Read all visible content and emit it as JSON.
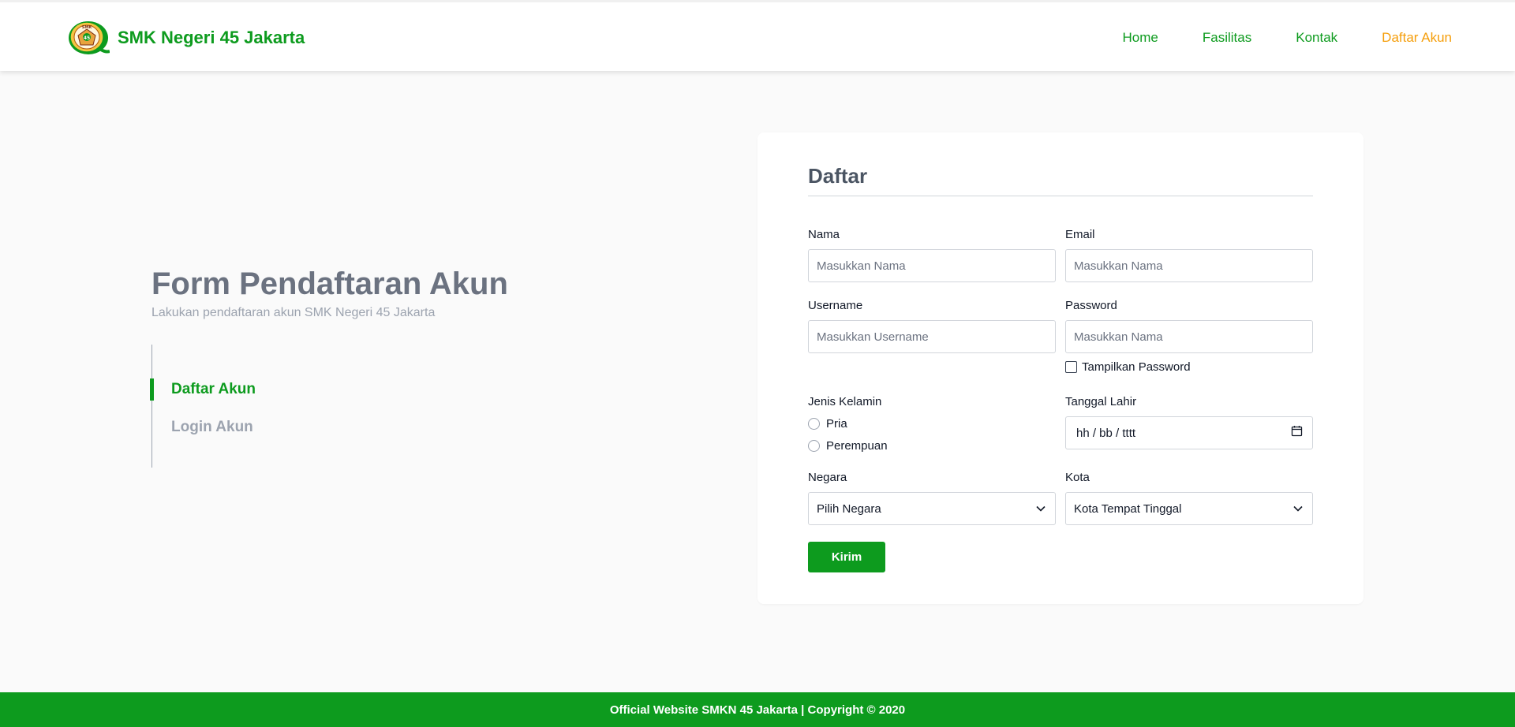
{
  "colors": {
    "brand": "#0d9b1e",
    "active_nav": "#f59e0b",
    "muted": "#9ca3af",
    "heading": "#6b7280"
  },
  "header": {
    "logo_icon": "school-emblem-icon",
    "logo_text": "SMK",
    "brand_name": "SMK Negeri 45 Jakarta",
    "nav": [
      {
        "label": "Home",
        "active": false
      },
      {
        "label": "Fasilitas",
        "active": false
      },
      {
        "label": "Kontak",
        "active": false
      },
      {
        "label": "Daftar Akun",
        "active": true
      }
    ]
  },
  "intro": {
    "title": "Form Pendaftaran Akun",
    "subtitle": "Lakukan pendaftaran akun SMK Negeri 45 Jakarta",
    "menu": [
      {
        "label": "Daftar Akun",
        "active": true
      },
      {
        "label": "Login Akun",
        "active": false
      }
    ]
  },
  "form": {
    "title": "Daftar",
    "nama": {
      "label": "Nama",
      "placeholder": "Masukkan Nama"
    },
    "email": {
      "label": "Email",
      "placeholder": "Masukkan Nama"
    },
    "username": {
      "label": "Username",
      "placeholder": "Masukkan Username"
    },
    "password": {
      "label": "Password",
      "placeholder": "Masukkan Nama"
    },
    "show_password": {
      "label": "Tampilkan Password",
      "checked": false
    },
    "gender": {
      "label": "Jenis Kelamin",
      "options": [
        "Pria",
        "Perempuan"
      ]
    },
    "birthdate": {
      "label": "Tanggal Lahir",
      "placeholder": "hh / bb / tttt",
      "icon": "calendar-icon"
    },
    "country": {
      "label": "Negara",
      "selected": "Pilih Negara",
      "icon": "chevron-down-icon"
    },
    "city": {
      "label": "Kota",
      "selected": "Kota Tempat Tinggal",
      "icon": "chevron-down-icon"
    },
    "submit_label": "Kirim"
  },
  "footer": {
    "text": "Official Website SMKN 45 Jakarta | Copyright © 2020"
  }
}
